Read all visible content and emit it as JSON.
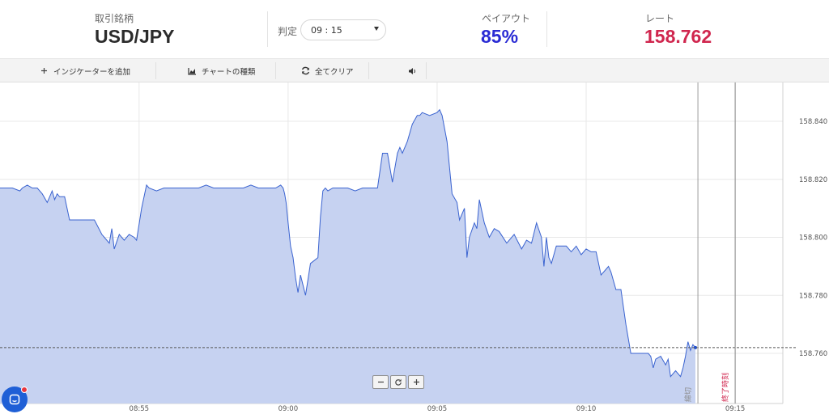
{
  "header": {
    "symbol_label": "取引銘柄",
    "symbol": "USD/JPY",
    "expiry_label": "判定",
    "expiry_value": "09 : 15",
    "payout_label": "ペイアウト",
    "payout": "85%",
    "rate_label": "レート",
    "rate": "158.762"
  },
  "toolbar": {
    "add_indicator": "インジケーターを追加",
    "chart_type": "チャートの種類",
    "clear_all": "全てクリア",
    "sound_icon": "speaker-icon"
  },
  "chart_data": {
    "type": "area",
    "x_ticks": [
      "08:55",
      "09:00",
      "09:05",
      "09:10",
      "09:15"
    ],
    "y_ticks": [
      "158.840",
      "158.820",
      "158.800",
      "158.780",
      "158.760"
    ],
    "ylim": [
      158.744,
      158.848
    ],
    "xlim": [
      "08:50:20",
      "09:16:36"
    ],
    "grid": true,
    "current_rate": 158.762,
    "markers": [
      {
        "label": "締切",
        "time": "09:13:45"
      },
      {
        "label": "終了時刻",
        "time": "09:15:00"
      }
    ],
    "series": [
      {
        "x": [
          "08:50:20",
          "08:50:45",
          "08:51:00",
          "08:51:05",
          "08:51:15",
          "08:51:25",
          "08:51:35",
          "08:51:45",
          "08:51:55",
          "08:52:00",
          "08:52:05",
          "08:52:10",
          "08:52:15",
          "08:52:20",
          "08:52:30",
          "08:52:40",
          "08:52:50",
          "08:53:00",
          "08:53:06",
          "08:53:10",
          "08:53:30",
          "08:53:45",
          "08:54:00",
          "08:54:05",
          "08:54:10",
          "08:54:20",
          "08:54:30",
          "08:54:40",
          "08:54:50",
          "08:54:55",
          "08:55:05",
          "08:55:15",
          "08:55:20",
          "08:55:35",
          "08:55:50",
          "08:56:10",
          "08:56:30",
          "08:56:45",
          "08:57:00",
          "08:57:15",
          "08:57:30",
          "08:57:45",
          "08:58:00",
          "08:58:15",
          "08:58:30",
          "08:58:45",
          "08:59:00",
          "08:59:10",
          "08:59:15",
          "08:59:25",
          "08:59:30",
          "08:59:35",
          "08:59:45",
          "08:59:50",
          "08:59:53",
          "08:59:56",
          "09:00:00",
          "09:00:05",
          "09:00:10",
          "09:00:15",
          "09:00:20",
          "09:00:25",
          "09:00:35",
          "09:00:45",
          "09:01:00",
          "09:01:05",
          "09:01:10",
          "09:01:15",
          "09:01:20",
          "09:01:30",
          "09:01:45",
          "09:02:00",
          "09:02:15",
          "09:02:30",
          "09:02:40",
          "09:02:50",
          "09:03:00",
          "09:03:10",
          "09:03:20",
          "09:03:30",
          "09:03:40",
          "09:03:45",
          "09:03:50",
          "09:04:00",
          "09:04:10",
          "09:04:20",
          "09:04:25",
          "09:04:30",
          "09:04:45",
          "09:05:00",
          "09:05:05",
          "09:05:10",
          "09:05:20",
          "09:05:30",
          "09:05:40",
          "09:05:45",
          "09:05:55",
          "09:06:00",
          "09:06:05",
          "09:06:15",
          "09:06:20",
          "09:06:25",
          "09:06:35",
          "09:06:45",
          "09:06:55",
          "09:07:05",
          "09:07:20",
          "09:07:35",
          "09:07:50",
          "09:08:00",
          "09:08:10",
          "09:08:20",
          "09:08:30",
          "09:08:35",
          "09:08:40",
          "09:08:45",
          "09:08:50",
          "09:09:00",
          "09:09:10",
          "09:09:20",
          "09:09:30",
          "09:09:40",
          "09:09:50",
          "09:10:00",
          "09:10:10",
          "09:10:20",
          "09:10:30",
          "09:10:40",
          "09:10:45",
          "09:10:50",
          "09:11:00",
          "09:11:10",
          "09:11:20",
          "09:11:30",
          "09:11:45",
          "09:12:00",
          "09:12:05",
          "09:12:10",
          "09:12:15",
          "09:12:20",
          "09:12:30",
          "09:12:40",
          "09:12:45",
          "09:12:50",
          "09:13:00",
          "09:13:10",
          "09:13:15",
          "09:13:20",
          "09:13:25",
          "09:13:30",
          "09:13:35",
          "09:13:40"
        ],
        "y": [
          158.817,
          158.817,
          158.816,
          158.817,
          158.818,
          158.817,
          158.817,
          158.815,
          158.812,
          158.814,
          158.816,
          158.813,
          158.815,
          158.814,
          158.814,
          158.806,
          158.806,
          158.806,
          158.806,
          158.806,
          158.806,
          158.801,
          158.798,
          158.803,
          158.796,
          158.801,
          158.799,
          158.801,
          158.8,
          158.799,
          158.81,
          158.818,
          158.817,
          158.816,
          158.817,
          158.817,
          158.817,
          158.817,
          158.817,
          158.818,
          158.817,
          158.817,
          158.817,
          158.817,
          158.817,
          158.818,
          158.817,
          158.817,
          158.817,
          158.817,
          158.817,
          158.817,
          158.818,
          158.817,
          158.815,
          158.812,
          158.805,
          158.797,
          158.793,
          158.786,
          158.781,
          158.787,
          158.78,
          158.791,
          158.793,
          158.807,
          158.816,
          158.817,
          158.816,
          158.817,
          158.817,
          158.817,
          158.816,
          158.817,
          158.817,
          158.817,
          158.817,
          158.829,
          158.829,
          158.819,
          158.829,
          158.831,
          158.829,
          158.833,
          158.839,
          158.842,
          158.842,
          158.843,
          158.842,
          158.843,
          158.844,
          158.842,
          158.833,
          158.815,
          158.812,
          158.806,
          158.81,
          158.793,
          158.8,
          158.805,
          158.803,
          158.813,
          158.805,
          158.8,
          158.803,
          158.802,
          158.798,
          158.801,
          158.796,
          158.799,
          158.798,
          158.805,
          158.8,
          158.79,
          158.8,
          158.793,
          158.791,
          158.797,
          158.797,
          158.797,
          158.795,
          158.797,
          158.794,
          158.796,
          158.795,
          158.795,
          158.787,
          158.789,
          158.79,
          158.788,
          158.782,
          158.782,
          158.77,
          158.76,
          158.76,
          158.76,
          158.76,
          158.759,
          158.755,
          158.758,
          158.759,
          158.756,
          158.758,
          158.752,
          158.754,
          158.752,
          158.755,
          158.759,
          158.764,
          158.761,
          158.763,
          158.762
        ]
      }
    ]
  }
}
